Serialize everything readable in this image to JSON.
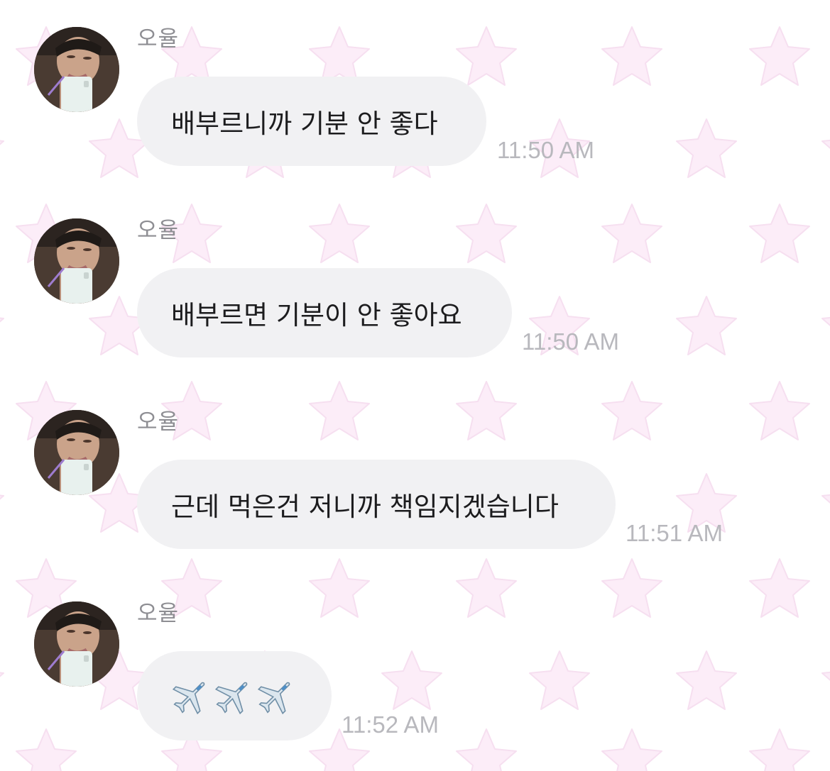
{
  "chat": {
    "background_star_color": "#fbe8f6",
    "bubble_color": "#f1f1f3",
    "messages": [
      {
        "sender": "오율",
        "text": "배부르니까 기분 안 좋다",
        "time": "11:50 AM",
        "avatar_icon": "profile-photo"
      },
      {
        "sender": "오율",
        "text": "배부르면 기분이 안 좋아요",
        "time": "11:50 AM",
        "avatar_icon": "profile-photo"
      },
      {
        "sender": "오율",
        "text": "근데 먹은건 저니까 책임지겠습니다",
        "time": "11:51 AM",
        "avatar_icon": "profile-photo"
      },
      {
        "sender": "오율",
        "text": "",
        "emoji": [
          "airplane-icon",
          "airplane-icon",
          "airplane-icon"
        ],
        "time": "11:52 AM",
        "avatar_icon": "profile-photo"
      }
    ]
  }
}
